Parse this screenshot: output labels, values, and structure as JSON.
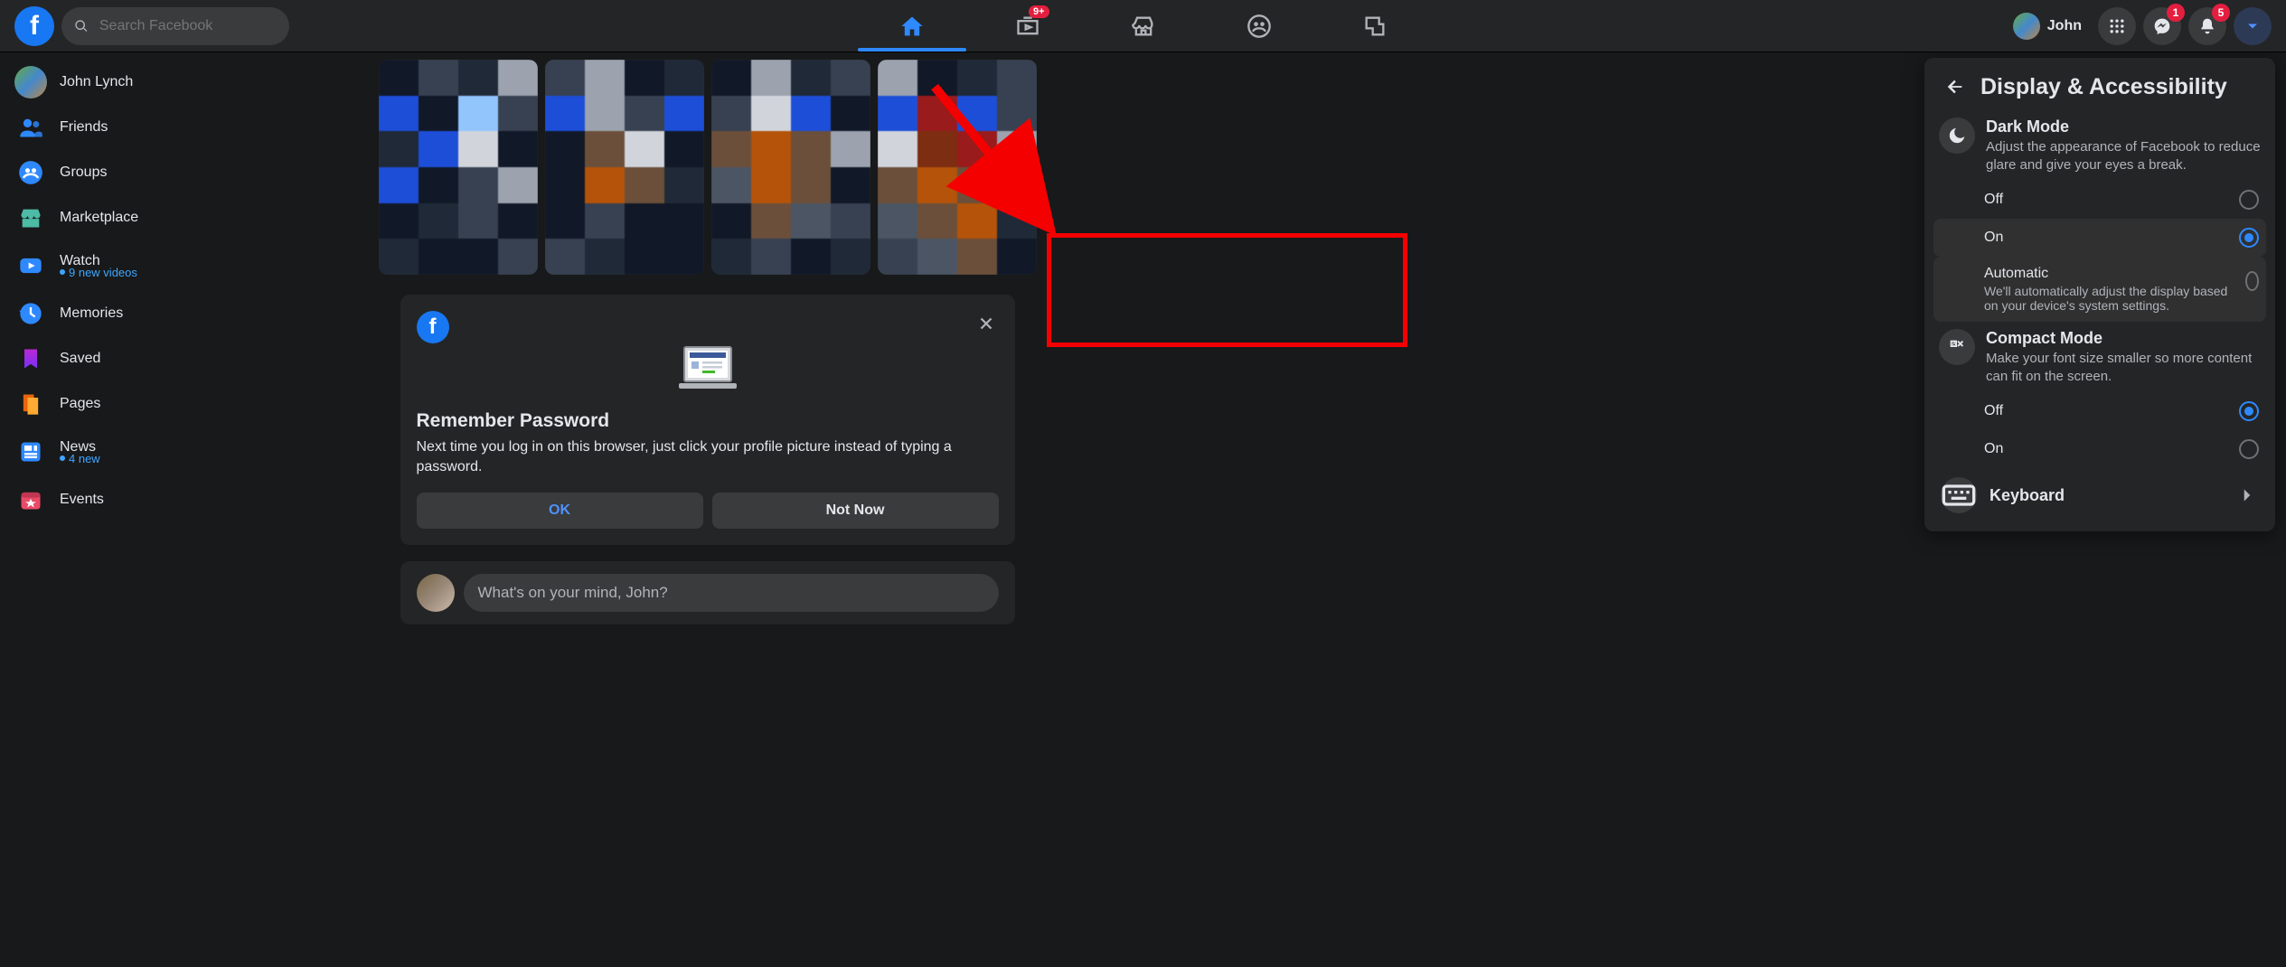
{
  "header": {
    "search_placeholder": "Search Facebook",
    "watch_badge": "9+",
    "profile_name": "John",
    "messenger_badge": "1",
    "notifications_badge": "5"
  },
  "sidebar": {
    "items": [
      {
        "label": "John Lynch",
        "sub": ""
      },
      {
        "label": "Friends",
        "sub": ""
      },
      {
        "label": "Groups",
        "sub": ""
      },
      {
        "label": "Marketplace",
        "sub": ""
      },
      {
        "label": "Watch",
        "sub": "9 new videos"
      },
      {
        "label": "Memories",
        "sub": ""
      },
      {
        "label": "Saved",
        "sub": ""
      },
      {
        "label": "Pages",
        "sub": ""
      },
      {
        "label": "News",
        "sub": "4 new"
      },
      {
        "label": "Events",
        "sub": ""
      }
    ]
  },
  "prompt_card": {
    "title": "Remember Password",
    "body": "Next time you log in on this browser, just click your profile picture instead of typing a password.",
    "ok": "OK",
    "not_now": "Not Now"
  },
  "composer": {
    "placeholder": "What's on your mind, John?"
  },
  "panel": {
    "title": "Display & Accessibility",
    "dark_mode": {
      "title": "Dark Mode",
      "desc": "Adjust the appearance of Facebook to reduce glare and give your eyes a break.",
      "off": "Off",
      "on": "On",
      "auto": "Automatic",
      "auto_desc": "We'll automatically adjust the display based on your device's system settings.",
      "selected": "on"
    },
    "compact": {
      "title": "Compact Mode",
      "desc": "Make your font size smaller so more content can fit on the screen.",
      "off": "Off",
      "on": "On",
      "selected": "off"
    },
    "keyboard": "Keyboard"
  }
}
